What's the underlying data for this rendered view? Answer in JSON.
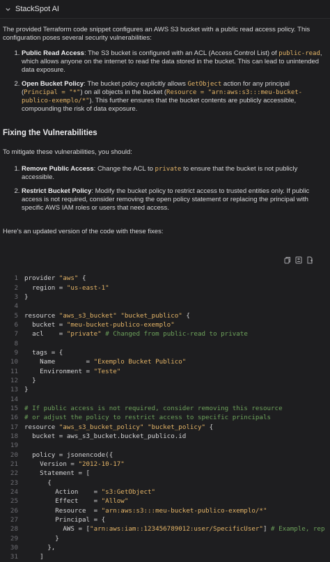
{
  "header": {
    "title": "StackSpot AI"
  },
  "intro": "The provided Terraform code snippet configures an AWS S3 bucket with a public read access policy. This configuration poses several security vulnerabilities:",
  "vulns": [
    {
      "title": "Public Read Access",
      "pre": ": The S3 bucket is configured with an ACL (Access Control List) of ",
      "code1": "public-read",
      "post": ", which allows anyone on the internet to read the data stored in the bucket. This can lead to unintended data exposure."
    },
    {
      "title": "Open Bucket Policy",
      "pre": ": The bucket policy explicitly allows ",
      "code1": "GetObject",
      "mid1": " action for any principal (",
      "code2": "Principal = \"*\"",
      "mid2": ") on all objects in the bucket (",
      "code3": "Resource = \"arn:aws:s3:::meu-bucket-publico-exemplo/*\"",
      "post": "). This further ensures that the bucket contents are publicly accessible, compounding the risk of data exposure."
    }
  ],
  "fix_heading": "Fixing the Vulnerabilities",
  "mitigate": "To mitigate these vulnerabilities, you should:",
  "fixes": [
    {
      "title": "Remove Public Access",
      "pre": ": Change the ACL to ",
      "code1": "private",
      "post": " to ensure that the bucket is not publicly accessible."
    },
    {
      "title": "Restrict Bucket Policy",
      "pre": ": Modify the bucket policy to restrict access to trusted entities only. If public access is not required, consider removing the open policy statement or replacing the principal with specific AWS IAM roles or users that need access.",
      "code1": "",
      "post": ""
    }
  ],
  "updated": "Here's an updated version of the code with these fixes:",
  "toolbar": {
    "icons": [
      "copy-icon",
      "diff-icon",
      "insert-icon"
    ]
  },
  "code_lines": [
    [
      [
        "t",
        "provider "
      ],
      [
        "s",
        "\"aws\""
      ],
      [
        "t",
        " {"
      ]
    ],
    [
      [
        "t",
        "  region = "
      ],
      [
        "s",
        "\"us-east-1\""
      ]
    ],
    [
      [
        "t",
        "}"
      ]
    ],
    [],
    [
      [
        "t",
        "resource "
      ],
      [
        "s",
        "\"aws_s3_bucket\""
      ],
      [
        "t",
        " "
      ],
      [
        "s",
        "\"bucket_publico\""
      ],
      [
        "t",
        " {"
      ]
    ],
    [
      [
        "t",
        "  bucket = "
      ],
      [
        "s",
        "\"meu-bucket-publico-exemplo\""
      ]
    ],
    [
      [
        "t",
        "  acl    = "
      ],
      [
        "s",
        "\"private\""
      ],
      [
        "c",
        " # Changed from public-read to private"
      ]
    ],
    [],
    [
      [
        "t",
        "  tags = {"
      ]
    ],
    [
      [
        "t",
        "    Name        = "
      ],
      [
        "s",
        "\"Exemplo Bucket Publico\""
      ]
    ],
    [
      [
        "t",
        "    Environment = "
      ],
      [
        "s",
        "\"Teste\""
      ]
    ],
    [
      [
        "t",
        "  }"
      ]
    ],
    [
      [
        "t",
        "}"
      ]
    ],
    [],
    [
      [
        "c",
        "# If public access is not required, consider removing this resource"
      ]
    ],
    [
      [
        "c",
        "# or adjust the policy to restrict access to specific principals"
      ]
    ],
    [
      [
        "t",
        "resource "
      ],
      [
        "s",
        "\"aws_s3_bucket_policy\""
      ],
      [
        "t",
        " "
      ],
      [
        "s",
        "\"bucket_policy\""
      ],
      [
        "t",
        " {"
      ]
    ],
    [
      [
        "t",
        "  bucket = aws_s3_bucket.bucket_publico.id"
      ]
    ],
    [],
    [
      [
        "t",
        "  policy = jsonencode({"
      ]
    ],
    [
      [
        "t",
        "    Version = "
      ],
      [
        "s",
        "\"2012-10-17\""
      ]
    ],
    [
      [
        "t",
        "    Statement = ["
      ]
    ],
    [
      [
        "t",
        "      {"
      ]
    ],
    [
      [
        "t",
        "        Action    = "
      ],
      [
        "s",
        "\"s3:GetObject\""
      ]
    ],
    [
      [
        "t",
        "        Effect    = "
      ],
      [
        "s",
        "\"Allow\""
      ]
    ],
    [
      [
        "t",
        "        Resource  = "
      ],
      [
        "s",
        "\"arn:aws:s3:::meu-bucket-publico-exemplo/*\""
      ]
    ],
    [
      [
        "t",
        "        Principal = {"
      ]
    ],
    [
      [
        "t",
        "          AWS = ["
      ],
      [
        "s",
        "\"arn:aws:iam::123456789012:user/SpecificUser\""
      ],
      [
        "t",
        "] "
      ],
      [
        "c",
        "# Example, rep"
      ]
    ],
    [
      [
        "t",
        "        }"
      ]
    ],
    [
      [
        "t",
        "      },"
      ]
    ],
    [
      [
        "t",
        "    ]"
      ]
    ]
  ]
}
